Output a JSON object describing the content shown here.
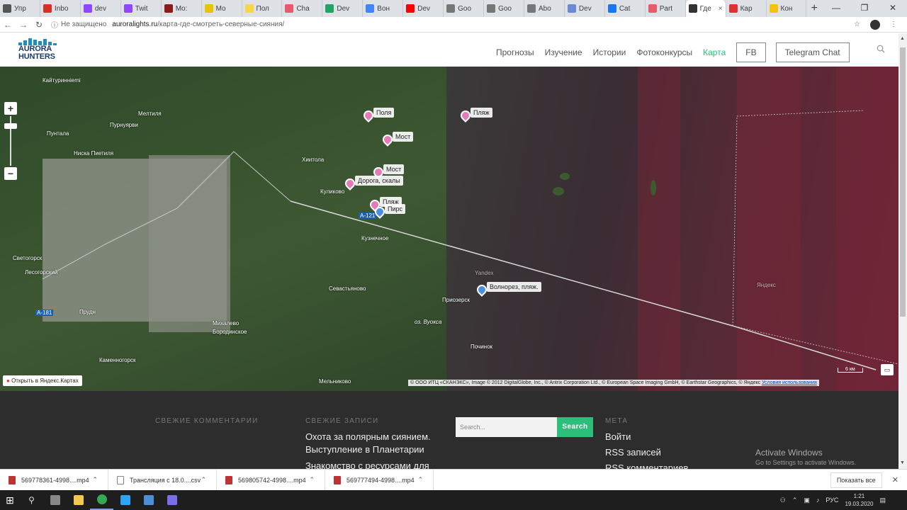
{
  "browser": {
    "tabs": [
      {
        "label": "Упр",
        "color": "#555555",
        "active": false
      },
      {
        "label": "Inbo",
        "color": "#d93025",
        "active": false
      },
      {
        "label": "dev",
        "color": "#9146ff",
        "active": false
      },
      {
        "label": "Twit",
        "color": "#9146ff",
        "active": false
      },
      {
        "label": "Mo:",
        "color": "#8b1a1a",
        "active": false
      },
      {
        "label": "Mo",
        "color": "#e8c400",
        "active": false
      },
      {
        "label": "Пол",
        "color": "#f7d64a",
        "active": false
      },
      {
        "label": "Cha",
        "color": "#e8596b",
        "active": false
      },
      {
        "label": "Dev",
        "color": "#1fa463",
        "active": false
      },
      {
        "label": "Вон",
        "color": "#4285f4",
        "active": false
      },
      {
        "label": "Dev",
        "color": "#ff0000",
        "active": false
      },
      {
        "label": "Goo",
        "color": "#777777",
        "active": false
      },
      {
        "label": "Goo",
        "color": "#777777",
        "active": false
      },
      {
        "label": "Abo",
        "color": "#777777",
        "active": false
      },
      {
        "label": "Dev",
        "color": "#6b8ad6",
        "active": false
      },
      {
        "label": "Cat",
        "color": "#1877f2",
        "active": false
      },
      {
        "label": "Part",
        "color": "#e8596b",
        "active": false
      },
      {
        "label": "Где",
        "color": "#333333",
        "active": true
      },
      {
        "label": "Кар",
        "color": "#e03131",
        "active": false
      },
      {
        "label": "Кон",
        "color": "#f4c20d",
        "active": false
      }
    ],
    "new_tab": "+",
    "window_buttons": [
      "—",
      "❐",
      "✕"
    ],
    "address": {
      "security": "Не защищено",
      "domain": "auroralights.ru",
      "path": "/карта-где-смотреть-северные-сияния/"
    }
  },
  "site": {
    "logo": {
      "line1": "AURORA",
      "line2": "HUNTERS"
    },
    "nav": [
      {
        "label": "Прогнозы",
        "active": false,
        "boxed": false
      },
      {
        "label": "Изучение",
        "active": false,
        "boxed": false
      },
      {
        "label": "Истории",
        "active": false,
        "boxed": false
      },
      {
        "label": "Фотоконкурсы",
        "active": false,
        "boxed": false
      },
      {
        "label": "Карта",
        "active": true,
        "boxed": false
      },
      {
        "label": "FB",
        "active": false,
        "boxed": true
      },
      {
        "label": "Telegram Chat",
        "active": false,
        "boxed": true
      }
    ],
    "accent_color": "#2bbf7a"
  },
  "map": {
    "zoom_in": "+",
    "zoom_out": "−",
    "markers": [
      {
        "label": "Поля",
        "color": "#e57ab8"
      },
      {
        "label": "Мост",
        "color": "#e57ab8"
      },
      {
        "label": "Пляж",
        "color": "#e57ab8"
      },
      {
        "label": "Мост",
        "color": "#e57ab8"
      },
      {
        "label": "Дорога, скалы",
        "color": "#e57ab8"
      },
      {
        "label": "Пляж",
        "color": "#e57ab8"
      },
      {
        "label": "Пирс",
        "color": "#4a8fe0"
      },
      {
        "label": "Волнорез, пляж.",
        "color": "#4a8fe0"
      }
    ],
    "place_labels": [
      "Кайтуриннiemi",
      "Мелтиля",
      "Пунтала",
      "Пурнуярви",
      "Ниска Пиетиля",
      "Хиитола",
      "Куликово",
      "Кузнечное",
      "Светогорск",
      "Лесогорский",
      "Севастьяново",
      "Приозерск",
      "оз. Вуокса",
      "Михалево",
      "Бородинское",
      "Прудн",
      "Каменногорск",
      "Мельниково",
      "Починок",
      "Yandex",
      "Яндекс"
    ],
    "road_labels": [
      "A-121",
      "A-181"
    ],
    "open_in_yandex": "Открыть в Яндекс.Картах",
    "copyright": "© ООО ИТЦ «СКАНЭКС», Image © 2012 DigitalGlobe, Inc., © Antrix Corporation Ltd., © European Space Imaging GmbH, © Earthstar Geographics, © Яндекс",
    "terms_link": "Условия использования",
    "scale": "6 км"
  },
  "footer": {
    "comments_heading": "СВЕЖИЕ КОММЕНТАРИИ",
    "posts_heading": "СВЕЖИЕ ЗАПИСИ",
    "posts": [
      "Охота за полярным сиянием. Выступление в Планетарии",
      "Знакомство с ресурсами для"
    ],
    "search_placeholder": "Search...",
    "search_button": "Search",
    "meta_heading": "МЕТА",
    "meta_links": [
      "Войти",
      "RSS записей",
      "RSS комментариев"
    ],
    "activate_title": "Activate Windows",
    "activate_sub": "Go to Settings to activate Windows."
  },
  "downloads": {
    "items": [
      {
        "name": "569778361-4998....mp4",
        "type": "video"
      },
      {
        "name": "Трансляция с 18.0....csv",
        "type": "csv"
      },
      {
        "name": "569805742-4998....mp4",
        "type": "video"
      },
      {
        "name": "569777494-4998....mp4",
        "type": "video"
      }
    ],
    "show_all": "Показать все"
  },
  "taskbar": {
    "apps": [
      {
        "name": "task-view",
        "color": "#888888",
        "running": false
      },
      {
        "name": "file-explorer",
        "color": "#f2c94c",
        "running": false
      },
      {
        "name": "chrome",
        "color": "#34a853",
        "running": true
      },
      {
        "name": "photoshop",
        "color": "#2fa3f7",
        "running": false
      },
      {
        "name": "app-globe",
        "color": "#4a90d9",
        "running": false
      },
      {
        "name": "app-tool",
        "color": "#7a6ee6",
        "running": false
      }
    ],
    "language": "РУС",
    "time": "1:21",
    "date": "19.03.2020"
  }
}
